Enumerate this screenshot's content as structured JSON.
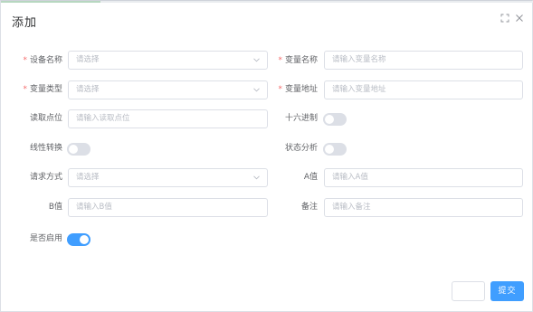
{
  "dialog": {
    "title": "添加",
    "icons": [
      "fullscreen-icon",
      "close-icon"
    ]
  },
  "form": {
    "device_name": {
      "label": "设备名称",
      "placeholder": "请选择",
      "required": true
    },
    "variable_name": {
      "label": "变量名称",
      "placeholder": "请输入变量名称",
      "required": true
    },
    "variable_type": {
      "label": "变量类型",
      "placeholder": "请选择",
      "required": true
    },
    "variable_address": {
      "label": "变量地址",
      "placeholder": "请输入变量地址",
      "required": true
    },
    "read_points": {
      "label": "读取点位",
      "placeholder": "请输入读取点位"
    },
    "hex": {
      "label": "十六进制",
      "on": false
    },
    "linear_conversion": {
      "label": "线性转换",
      "on": false
    },
    "status_analysis": {
      "label": "状态分析",
      "on": false
    },
    "request_method": {
      "label": "请求方式",
      "placeholder": "请选择"
    },
    "a_value": {
      "label": "A值",
      "placeholder": "请输入A值"
    },
    "b_value": {
      "label": "B值",
      "placeholder": "请输入B值"
    },
    "remark": {
      "label": "备注",
      "placeholder": "请输入备注"
    },
    "enabled": {
      "label": "是否启用",
      "on": true
    }
  },
  "footer": {
    "cancel_label": "",
    "submit_label": "提交"
  },
  "colors": {
    "primary": "#409eff",
    "required": "#f56c6c",
    "border": "#dcdfe6"
  }
}
